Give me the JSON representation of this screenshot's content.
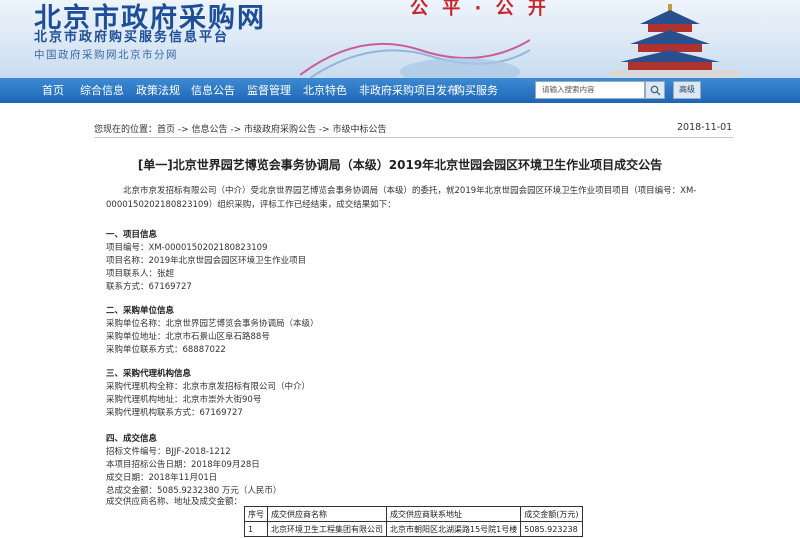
{
  "header": {
    "site_title": "北京市政府采购网",
    "subtitle": "北京市政府购买服务信息平台",
    "subtitle2": "中国政府采购网北京市分网",
    "slogan": "公 平 · 公 开"
  },
  "nav": {
    "items": [
      "首页",
      "综合信息",
      "政策法规",
      "信息公告",
      "监督管理",
      "北京特色",
      "非政府采购项目发布",
      "购买服务"
    ],
    "search_placeholder": "请输入搜索内容",
    "advanced_label": "高级"
  },
  "breadcrumb": {
    "prefix": "您现在的位置：",
    "path": "首页 -> 信息公告 -> 市级政府采购公告 -> 市级中标公告",
    "date": "2018-11-01"
  },
  "doc": {
    "title": "[单一]北京世界园艺博览会事务协调局（本级）2019年北京世园会园区环境卫生作业项目成交公告",
    "intro": "北京市京发招标有限公司（中介）受北京世界园艺博览会事务协调局（本级）的委托，就2019年北京世园会园区环境卫生作业项目项目（项目编号：XM-0000150202180823109）组织采购，评标工作已经结束，成交结果如下：",
    "sections": [
      {
        "title": "一、项目信息",
        "lines": [
          "项目编号：XM-0000150202180823109",
          "项目名称：2019年北京世园会园区环境卫生作业项目",
          "项目联系人：张超",
          "联系方式：67169727"
        ]
      },
      {
        "title": "二、采购单位信息",
        "lines": [
          "采购单位名称：北京世界园艺博览会事务协调局（本级）",
          "采购单位地址：北京市石景山区阜石路88号",
          "采购单位联系方式：68887022"
        ]
      },
      {
        "title": "三、采购代理机构信息",
        "lines": [
          "采购代理机构全称：北京市京发招标有限公司（中介）",
          "采购代理机构地址：北京市崇外大街90号",
          "采购代理机构联系方式：67169727"
        ]
      },
      {
        "title": "四、成交信息",
        "lines": [
          "招标文件编号：BJJF-2018-1212",
          "本项目招标公告日期：2018年09月28日",
          "成交日期：2018年11月01日",
          "总成交金额：5085.9232380 万元（人民币）",
          "成交供应商名称、地址及成交金额："
        ]
      }
    ],
    "table": {
      "headers": [
        "序号",
        "成交供应商名称",
        "成交供应商联系地址",
        "成交金额(万元)"
      ],
      "rows": [
        [
          "1",
          "北京环境卫生工程集团有限公司",
          "北京市朝阳区北湖渠路15号院1号楼",
          "5085.923238"
        ]
      ]
    }
  },
  "colors": {
    "nav_bg": "#1e66b5",
    "title_blue": "#1c4e9a",
    "slogan_red": "#c8262c"
  }
}
